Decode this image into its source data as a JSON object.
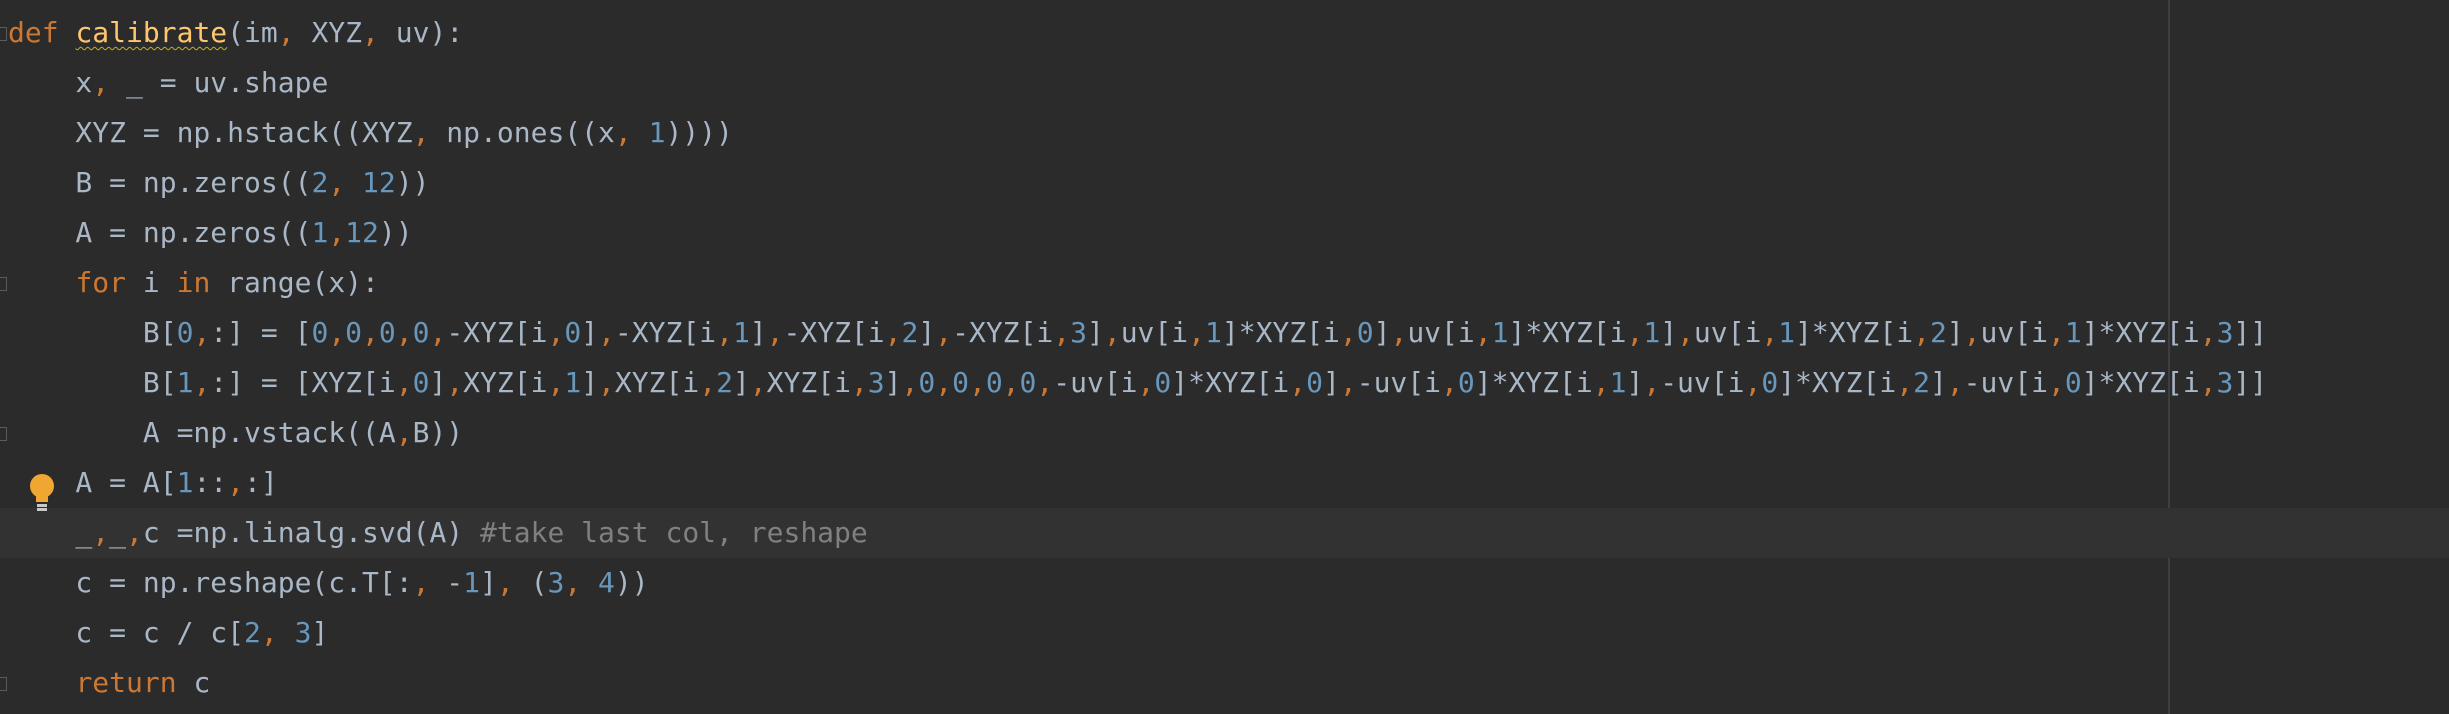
{
  "editor": {
    "lines": [
      "def calibrate(im, XYZ, uv):",
      "    x, _ = uv.shape",
      "    XYZ = np.hstack((XYZ, np.ones((x, 1))))",
      "    B = np.zeros((2, 12))",
      "    A = np.zeros((1,12))",
      "    for i in range(x):",
      "        B[0,:] = [0,0,0,0,-XYZ[i,0],-XYZ[i,1],-XYZ[i,2],-XYZ[i,3],uv[i,1]*XYZ[i,0],uv[i,1]*XYZ[i,1],uv[i,1]*XYZ[i,2],uv[i,1]*XYZ[i,3]]",
      "        B[1,:] = [XYZ[i,0],XYZ[i,1],XYZ[i,2],XYZ[i,3],0,0,0,0,-uv[i,0]*XYZ[i,0],-uv[i,0]*XYZ[i,1],-uv[i,0]*XYZ[i,2],-uv[i,0]*XYZ[i,3]]",
      "        A =np.vstack((A,B))",
      "    A = A[1::,:]",
      "    _,_,c =np.linalg.svd(A) #take last col, reshape",
      "    c = np.reshape(c.T[:, -1], (3, 4))",
      "    c = c / c[2, 3]",
      "    return c"
    ],
    "current_line": 11,
    "colors": {
      "background": "#2b2b2b",
      "current_line": "#323232",
      "keyword": "#cc7832",
      "function": "#ffc66d",
      "number": "#6897bb",
      "comment": "#808080",
      "text": "#a9b7c6",
      "warning_squiggle": "#bbb529"
    },
    "gutter_icons": [
      "fold-marker-icon",
      "lightbulb-icon"
    ]
  }
}
